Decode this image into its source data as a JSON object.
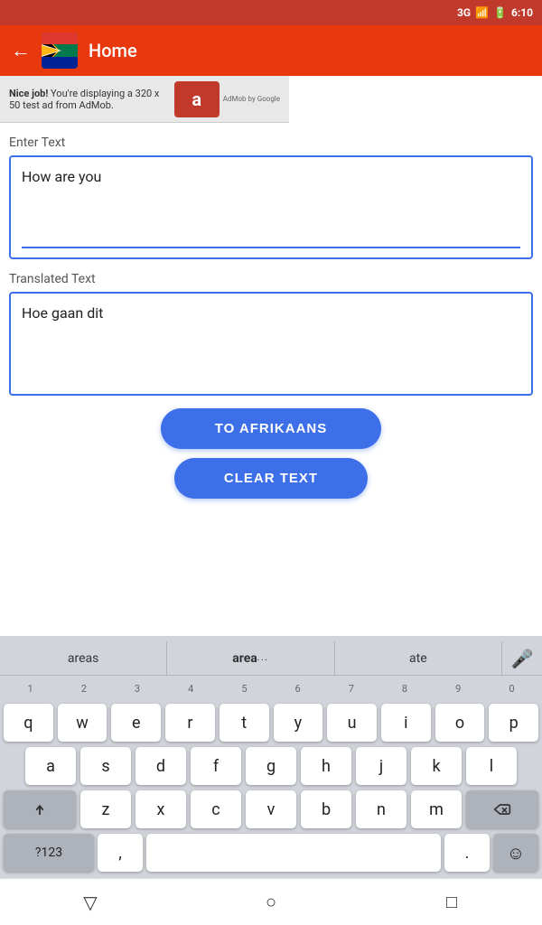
{
  "statusBar": {
    "signal": "3G",
    "signalBars": "▲",
    "battery": "🔋",
    "time": "6:10"
  },
  "appBar": {
    "title": "Home",
    "backLabel": "←"
  },
  "adBanner": {
    "text1": "Nice job!",
    "text2": " You're displaying a 320 x 50 test ad from AdMob.",
    "logoText": "a",
    "byText": "AdMob by Google"
  },
  "main": {
    "enterTextLabel": "Enter Text",
    "inputText": "How are you",
    "translatedTextLabel": "Translated Text",
    "translatedText": "Hoe gaan dit"
  },
  "buttons": {
    "toAfrikaans": "TO AFRIKAANS",
    "clearText": "CLEAR TEXT"
  },
  "keyboard": {
    "suggestions": [
      {
        "text": "areas",
        "bold": false
      },
      {
        "text": "area",
        "bold": true,
        "dots": "..."
      },
      {
        "text": "ate",
        "bold": false
      }
    ],
    "numRow": [
      "1",
      "2",
      "3",
      "4",
      "5",
      "6",
      "7",
      "8",
      "9",
      "0"
    ],
    "row1": [
      "q",
      "w",
      "e",
      "r",
      "t",
      "y",
      "u",
      "i",
      "o",
      "p"
    ],
    "row2": [
      "a",
      "s",
      "d",
      "f",
      "g",
      "h",
      "j",
      "k",
      "l"
    ],
    "row3": [
      "z",
      "x",
      "c",
      "v",
      "b",
      "n",
      "m"
    ],
    "bottomRow": {
      "specialLabel": "?123",
      "commaLabel": ",",
      "periodLabel": ".",
      "emojiLabel": "☺"
    }
  },
  "navBar": {
    "backBtn": "▽",
    "homeBtn": "○",
    "recentBtn": "□"
  }
}
